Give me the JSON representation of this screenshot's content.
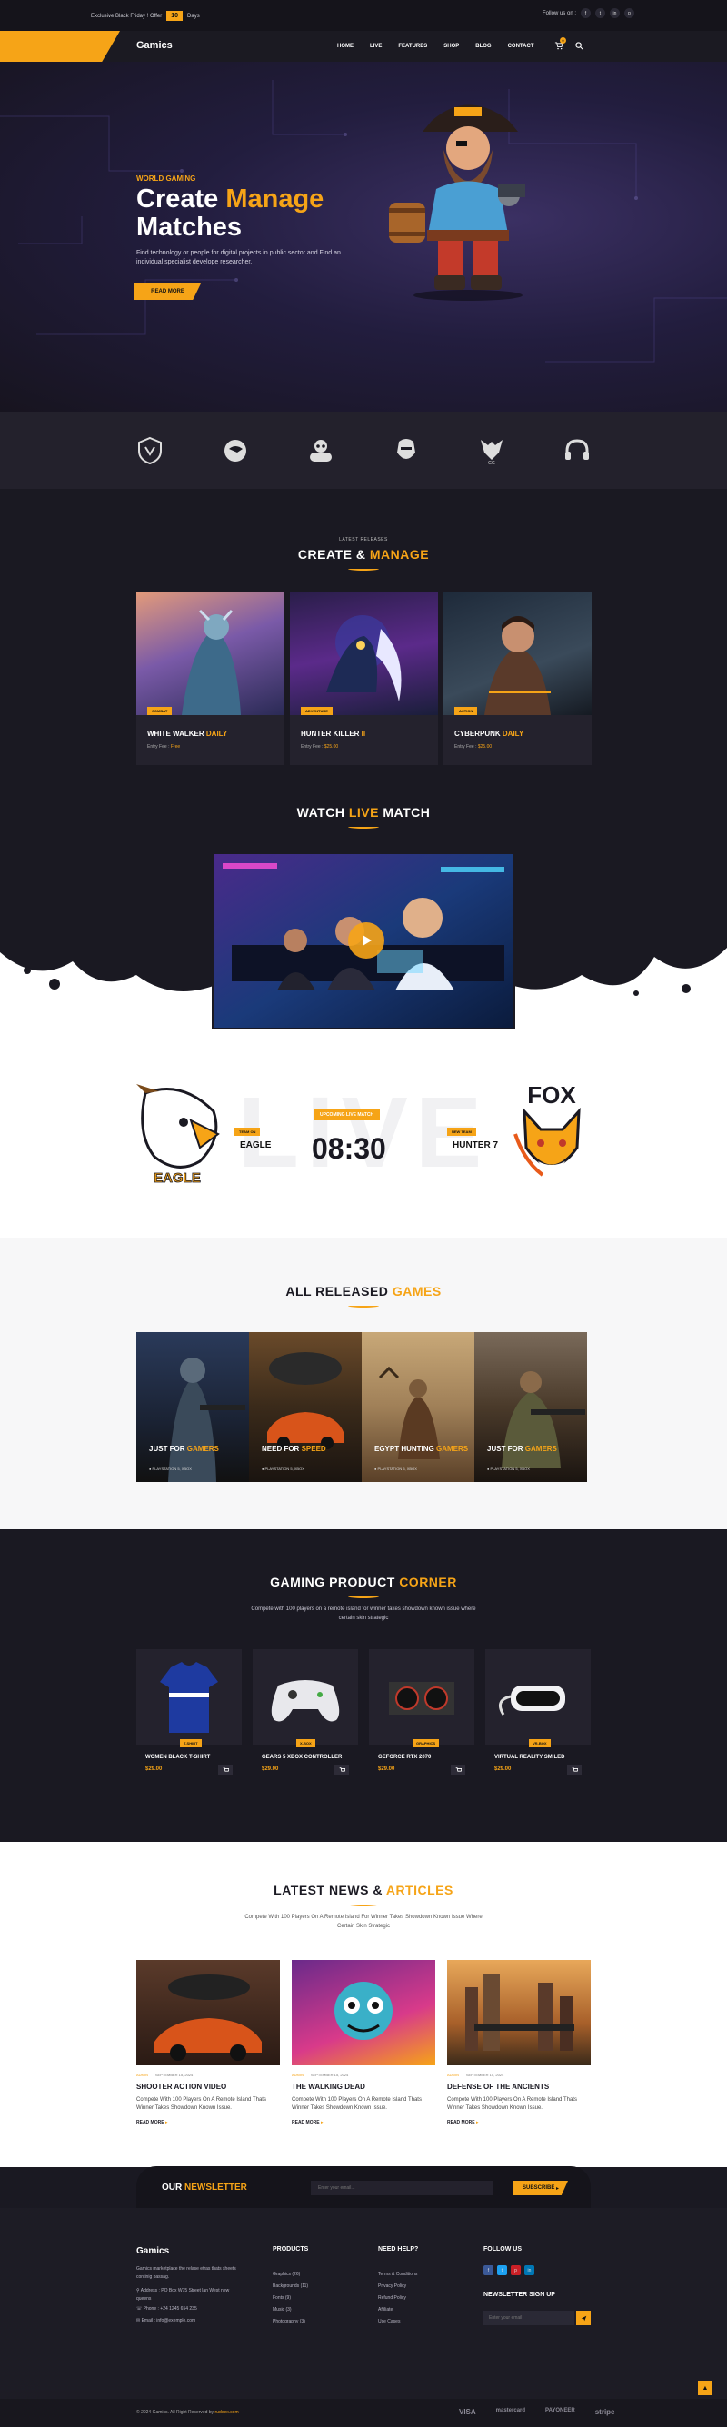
{
  "topbar": {
    "promo_text": "Exclusive Black Friday ! Offer",
    "days_count": "10",
    "days_label": "Days",
    "follow_label": "Follow us on :",
    "social": [
      "f",
      "t",
      "in",
      "p"
    ]
  },
  "nav": {
    "logo": "Gamics",
    "menu": [
      "HOME",
      "LIVE",
      "FEATURES",
      "SHOP",
      "BLOG",
      "CONTACT"
    ],
    "cart_count": "0",
    "icons": [
      "cart-icon",
      "search-icon"
    ]
  },
  "hero": {
    "kicker": "WORLD GAMING",
    "title_white": "Create ",
    "title_accent": "Manage",
    "title_line2": "Matches",
    "description": "Find technology or people for digital projects in public sector and Find an individual specialist develope researcher.",
    "button": "READ MORE"
  },
  "brands": [
    "shield-crest-icon",
    "eagle-emblem-icon",
    "gamepad-skull-icon",
    "warrior-mask-icon",
    "wolf-crest-icon",
    "headset-icon"
  ],
  "releases": {
    "kicker": "LATEST RELEASES",
    "title_white": "CREATE & ",
    "title_accent": "MANAGE",
    "cards": [
      {
        "tag": "COMBAT",
        "title_white": "WHITE WALKER ",
        "title_accent": "DAILY",
        "entry_label": "Entry Fee :",
        "entry_value": "Free"
      },
      {
        "tag": "ADVENTURE",
        "title_white": "HUNTER KILLER ",
        "title_accent": "II",
        "entry_label": "Entry Fee :",
        "entry_value": "$25.00"
      },
      {
        "tag": "ACTION",
        "title_white": "CYBERPUNK ",
        "title_accent": "DAILY",
        "entry_label": "Entry Fee :",
        "entry_value": "$25.00"
      }
    ]
  },
  "live": {
    "title_white": "WATCH ",
    "title_accent": "LIVE",
    "title_end": " MATCH",
    "bg_word": "LIVE",
    "upcoming": "UPCOMING LIVE MATCH",
    "timer": "08:30",
    "team_left": {
      "kicker": "TEAM ON",
      "name": "EAGLE",
      "logo_text": "EAGLE"
    },
    "team_right": {
      "kicker": "NEW TEAM",
      "name": "HUNTER 7",
      "logo_text": "FOX"
    }
  },
  "games": {
    "title_white": "ALL RELEASED ",
    "title_accent": "GAMES",
    "items": [
      {
        "white": "JUST FOR ",
        "accent": "GAMERS",
        "meta": "PLAYSTATION 5, XBOX"
      },
      {
        "white": "NEED FOR ",
        "accent": "SPEED",
        "meta": "PLAYSTATION 5, XBOX"
      },
      {
        "white": "EGYPT HUNTING ",
        "accent": "GAMERS",
        "meta": "PLAYSTATION 5, XBOX"
      },
      {
        "white": "JUST FOR ",
        "accent": "GAMERS",
        "meta": "PLAYSTATION 5, XBOX"
      }
    ]
  },
  "products": {
    "title_white": "GAMING PRODUCT ",
    "title_accent": "CORNER",
    "description": "Compete with 100 players on a remote island for winner takes showdown known issue where certain skin strategic",
    "items": [
      {
        "tag": "T-SHIRT",
        "name": "WOMEN BLACK T-SHIRT",
        "price": "$29.00"
      },
      {
        "tag": "X-BOX",
        "name": "GEARS 5 XBOX CONTROLLER",
        "price": "$29.00"
      },
      {
        "tag": "GRAPHICS",
        "name": "GEFORCE RTX 2070",
        "price": "$29.00"
      },
      {
        "tag": "VR-BOX",
        "name": "VIRTUAL REALITY SMILED",
        "price": "$29.00"
      }
    ]
  },
  "news": {
    "title_white": "LATEST NEWS & ",
    "title_accent": "ARTICLES",
    "description": "Compete With 100 Players On A Remote Island For Winner Takes Showdown Known Issue Where Certain Skin Strategic",
    "posts": [
      {
        "author": "ADMIN",
        "date": "SEPTEMBER 15, 2024",
        "title": "SHOOTER ACTION VIDEO",
        "excerpt": "Compete With 100 Players On A Remote Island Thats Winner Takes Showdown Known Issue.",
        "more": "READ MORE"
      },
      {
        "author": "ADMIN",
        "date": "SEPTEMBER 15, 2024",
        "title": "THE WALKING DEAD",
        "excerpt": "Compete With 100 Players On A Remote Island Thats Winner Takes Showdown Known Issue.",
        "more": "READ MORE"
      },
      {
        "author": "ADMIN",
        "date": "SEPTEMBER 15, 2024",
        "title": "DEFENSE OF THE ANCIENTS",
        "excerpt": "Compete With 100 Players On A Remote Island Thats Winner Takes Showdown Known Issue.",
        "more": "READ MORE"
      }
    ]
  },
  "newsletter": {
    "title_white": "OUR ",
    "title_accent": "NEWSLETTER",
    "placeholder": "Enter your email...",
    "button": "SUBSCRIBE"
  },
  "footer": {
    "logo": "Gamics",
    "about": "Gamics marketplace the relase etras thats sheets continig passag.",
    "address": "Address : PO Box W75 Street lan West new queens",
    "phone": "Phone : +24 1245 654 235",
    "email": "Email : info@exemple.com",
    "products_head": "PRODUCTS",
    "products": [
      "Graphics (26)",
      "Backgrounds (11)",
      "Fonts (9)",
      "Music (3)",
      "Photography (3)"
    ],
    "help_head": "NEED HELP?",
    "help": [
      "Terms & Conditions",
      "Privacy Policy",
      "Refund Policy",
      "Affiliate",
      "Use Cases"
    ],
    "follow_head": "FOLLOW US",
    "follow": [
      "f",
      "t",
      "p",
      "in"
    ],
    "signup_head": "NEWSLETTER SIGN UP",
    "signup_placeholder": "Enter your email",
    "copyright_pre": "© 2024 Gamics. All Right Reserved by ",
    "copyright_link": "rudeex.com",
    "payments": [
      "VISA",
      "mastercard",
      "PAYONEER",
      "stripe"
    ]
  },
  "colors": {
    "accent": "#f6a417",
    "dark": "#1a1922"
  }
}
